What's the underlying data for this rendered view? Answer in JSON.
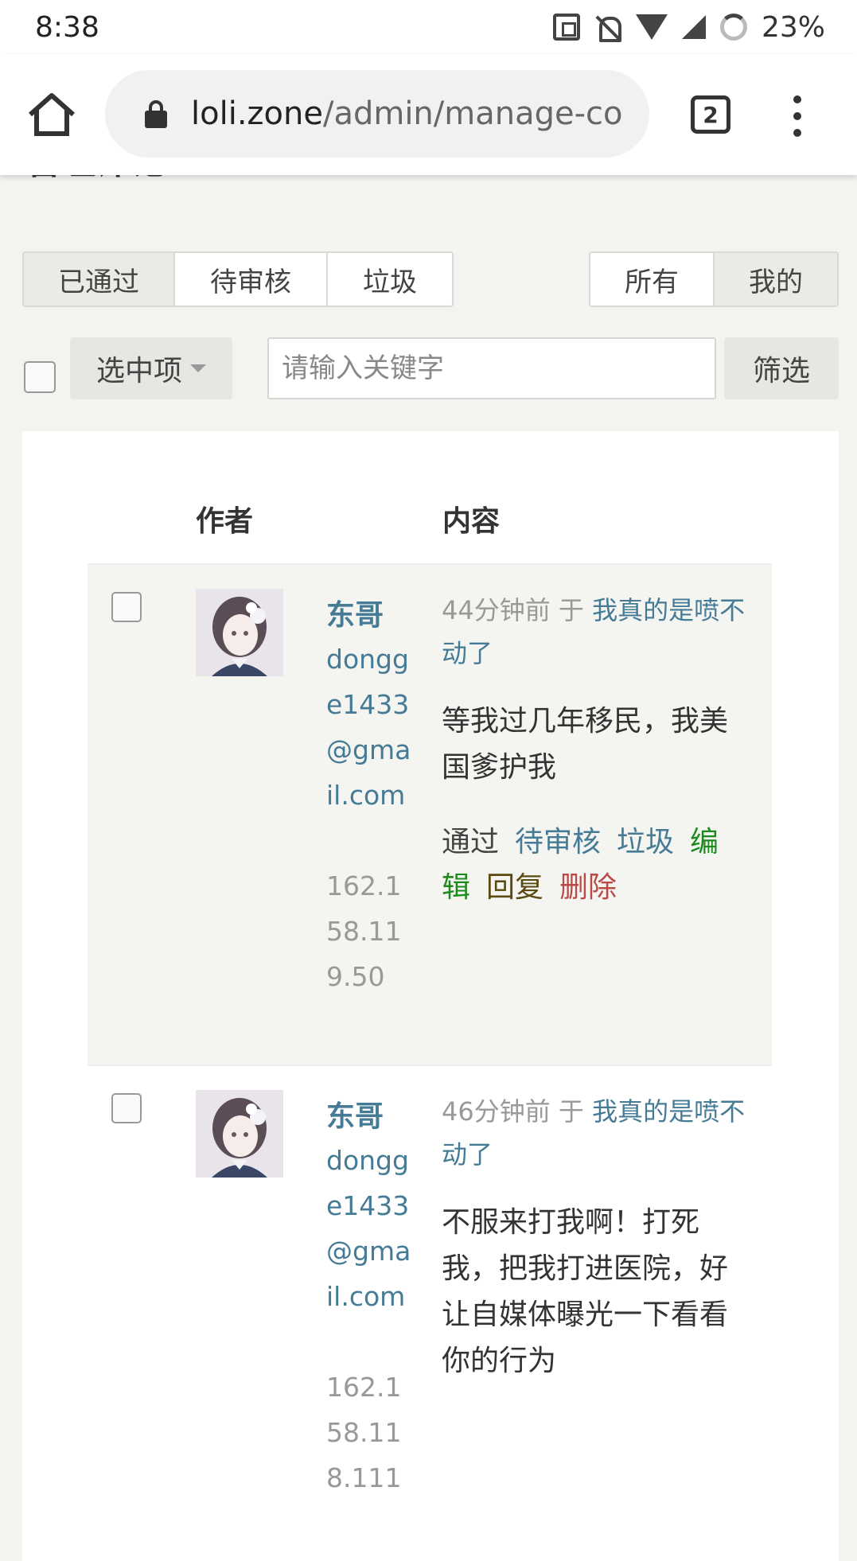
{
  "status_bar": {
    "time": "8:38",
    "battery": "23%"
  },
  "browser": {
    "url_host": "loli.zone",
    "url_path": "/admin/manage-co",
    "tab_count": "2"
  },
  "page": {
    "title": "管理评论"
  },
  "status_tabs": [
    "已通过",
    "待审核",
    "垃圾"
  ],
  "scope_tabs": [
    "所有",
    "我的"
  ],
  "toolbar": {
    "bulk_label": "选中项",
    "search_placeholder": "请输入关键字",
    "filter_label": "筛选"
  },
  "table": {
    "col_author": "作者",
    "col_content": "内容"
  },
  "comments": [
    {
      "author": "东哥",
      "email": "dongge1433@gmail.com",
      "ip": "162.158.119.50",
      "time": "44分钟前",
      "on": "于",
      "post": "我真的是喷不动了",
      "text": "等我过几年移民，我美国爹护我",
      "actions": {
        "approved": "通过",
        "pending": "待审核",
        "spam": "垃圾",
        "edit": "编辑",
        "reply": "回复",
        "delete": "删除"
      }
    },
    {
      "author": "东哥",
      "email": "dongge1433@gmail.com",
      "ip": "162.158.118.111",
      "time": "46分钟前",
      "on": "于",
      "post": "我真的是喷不动了",
      "text": "不服来打我啊！打死我，把我打进医院，好让自媒体曝光一下看看你的行为"
    }
  ],
  "colors": {
    "link": "#467b96",
    "edit": "#1e8a1e",
    "delete": "#b94a48",
    "background": "#f3f3f0"
  }
}
